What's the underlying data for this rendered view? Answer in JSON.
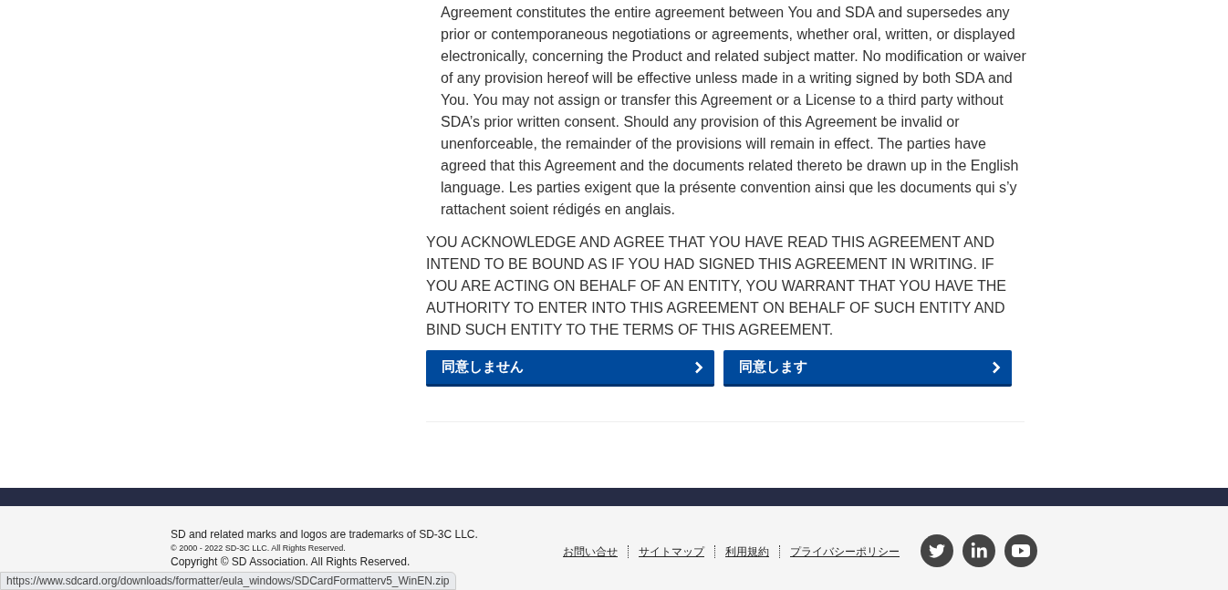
{
  "clause_lines": [
    "Agreement constitutes the entire agreement between You and SDA and supersedes any",
    "prior or contemporaneous negotiations or agreements, whether oral, written, or displayed",
    "electronically, concerning the Product and related subject matter. No modification or waiver",
    "of any provision hereof will be effective unless made in a writing signed by both SDA and",
    "You. You may not assign or transfer this Agreement or a License to a third party without",
    "SDA’s prior written consent. Should any provision of this Agreement be invalid or",
    "unenforceable, the remainder of the provisions will remain in effect. The parties have",
    "agreed that this Agreement and the documents related thereto be drawn up in the English",
    "language. Les parties exigent que la présente convention ainsi que les documents qui s’y",
    "rattachent soient rédigés en anglais."
  ],
  "acknowledgement": "YOU ACKNOWLEDGE AND AGREE THAT YOU HAVE READ THIS AGREEMENT AND INTEND TO BE BOUND AS IF YOU HAD SIGNED THIS AGREEMENT IN WRITING. IF YOU ARE ACTING ON BEHALF OF AN ENTITY, YOU WARRANT THAT YOU HAVE THE AUTHORITY TO ENTER INTO THIS AGREEMENT ON BEHALF OF SUCH ENTITY AND BIND SUCH ENTITY TO THE TERMS OF THIS AGREEMENT.",
  "buttons": [
    {
      "label": "同意しません"
    },
    {
      "label": "同意します"
    }
  ],
  "footer": {
    "legal": [
      "SD and related marks and logos are trademarks of SD-3C LLC.",
      "© 2000 - 2022 SD-3C LLC. All Rights Reserved.",
      "Copyright © SD Association. All Rights Reserved."
    ],
    "links": [
      "お問い合せ",
      "サイトマップ",
      "利用規約",
      "プライバシーポリシー"
    ],
    "social": [
      {
        "kind": "twitter"
      },
      {
        "kind": "linkedin"
      },
      {
        "kind": "youtube"
      }
    ]
  },
  "status_url": "https://www.sdcard.org/downloads/formatter/eula_windows/SDCardFormatterv5_WinEN.zip"
}
